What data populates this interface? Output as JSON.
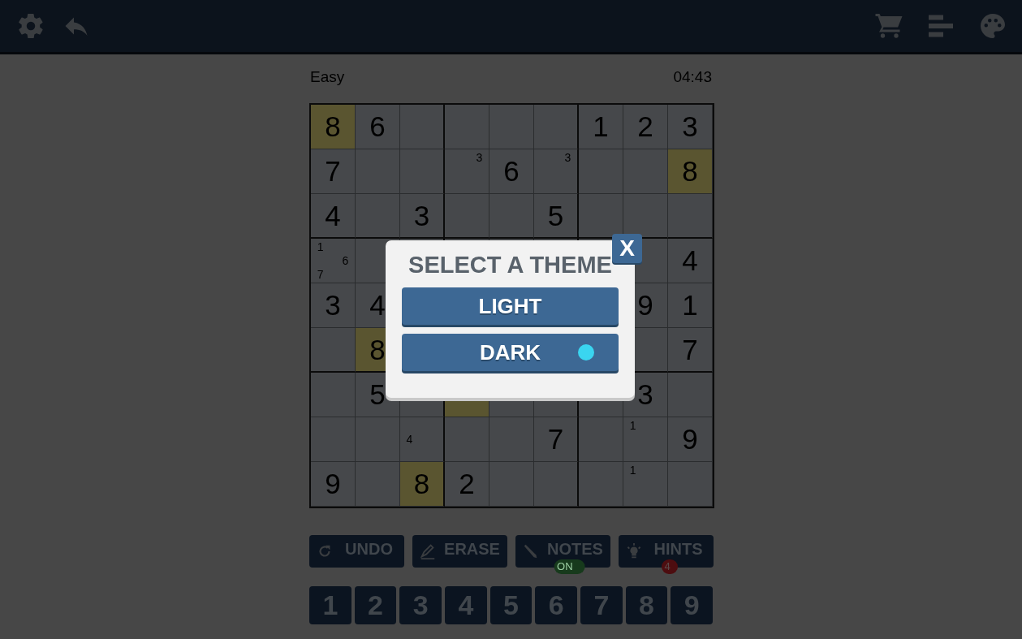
{
  "header": {
    "difficulty": "Easy",
    "timer": "04:43"
  },
  "grid": [
    [
      {
        "v": "8",
        "hl": true
      },
      {
        "v": "6",
        "hl": false
      },
      {
        "hl": false
      },
      {
        "hl": false
      },
      {
        "hl": false
      },
      {
        "hl": false
      },
      {
        "v": "1",
        "hl": false
      },
      {
        "v": "2",
        "hl": false
      },
      {
        "v": "3",
        "hl": false
      }
    ],
    [
      {
        "v": "7",
        "hl": false
      },
      {
        "hl": false
      },
      {
        "hl": false
      },
      {
        "notes": [
          "3"
        ],
        "hl": false
      },
      {
        "v": "6",
        "hl": false
      },
      {
        "notes": [
          "3"
        ],
        "hl": false
      },
      {
        "hl": false
      },
      {
        "hl": false
      },
      {
        "v": "8",
        "hl": true
      }
    ],
    [
      {
        "v": "4",
        "hl": false
      },
      {
        "hl": false
      },
      {
        "v": "3",
        "hl": false
      },
      {
        "hl": false
      },
      {
        "hl": false
      },
      {
        "v": "5",
        "hl": false
      },
      {
        "hl": false
      },
      {
        "hl": false
      },
      {
        "hl": false
      }
    ],
    [
      {
        "notes": [
          "1",
          "6",
          "7"
        ],
        "hl": false
      },
      {
        "hl": false
      },
      {
        "hl": false
      },
      {
        "hl": false
      },
      {
        "hl": false
      },
      {
        "hl": false
      },
      {
        "hl": false
      },
      {
        "hl": false
      },
      {
        "v": "4",
        "hl": false
      }
    ],
    {
      "left": [
        {
          "v": "3",
          "hl": false
        },
        {
          "v": "4",
          "hl": false
        }
      ],
      "right": [
        {
          "v": "9",
          "hl": false
        },
        {
          "v": "1",
          "hl": false
        }
      ]
    },
    {
      "left": [
        {
          "hl": false
        },
        {
          "v": "8",
          "hl": true
        }
      ],
      "right": [
        {
          "hl": false
        },
        {
          "v": "7",
          "hl": false
        }
      ]
    },
    [
      {
        "hl": false
      },
      {
        "v": "5",
        "hl": false
      },
      {
        "hl": false
      },
      {
        "hl": true
      },
      {
        "hl": false
      },
      {
        "hl": false
      },
      {
        "hl": false
      },
      {
        "v": "3",
        "hl": false
      },
      {
        "hl": false
      }
    ],
    [
      {
        "hl": false
      },
      {
        "hl": false
      },
      {
        "notes": [
          "4"
        ],
        "hl": false
      },
      {
        "hl": false
      },
      {
        "hl": false
      },
      {
        "v": "7",
        "hl": false
      },
      {
        "hl": false
      },
      {
        "notes": [
          "1"
        ],
        "hl": false
      },
      {
        "v": "9",
        "hl": false
      }
    ],
    [
      {
        "v": "9",
        "hl": false
      },
      {
        "hl": false
      },
      {
        "v": "8",
        "hl": true
      },
      {
        "v": "2",
        "hl": false
      },
      {
        "hl": false
      },
      {
        "hl": false
      },
      {
        "hl": false
      },
      {
        "notes": [
          "1"
        ],
        "hl": false
      },
      {
        "hl": false
      }
    ]
  ],
  "dialog": {
    "title": "SELECT A THEME",
    "close": "X",
    "themes": [
      {
        "label": "LIGHT",
        "selected": false
      },
      {
        "label": "DARK",
        "selected": true
      }
    ]
  },
  "tools": [
    {
      "kind": "undo",
      "label": "UNDO"
    },
    {
      "kind": "erase",
      "label": "ERASE"
    },
    {
      "kind": "notes",
      "label": "NOTES",
      "badge": "ON"
    },
    {
      "kind": "hints",
      "label": "HINTS",
      "badge": "4"
    }
  ],
  "numbers": [
    "1",
    "2",
    "3",
    "4",
    "5",
    "6",
    "7",
    "8",
    "9"
  ]
}
